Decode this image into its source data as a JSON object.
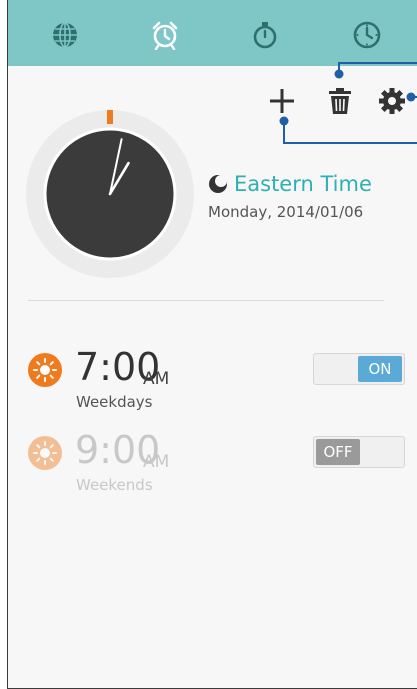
{
  "tabs": [
    {
      "name": "world-clock",
      "icon": "globe-icon"
    },
    {
      "name": "alarm",
      "icon": "alarm-clock-icon",
      "active": true
    },
    {
      "name": "stopwatch",
      "icon": "stopwatch-icon"
    },
    {
      "name": "timer",
      "icon": "timer-icon"
    }
  ],
  "toolbar": {
    "add_icon": "plus-icon",
    "delete_icon": "trash-icon",
    "settings_icon": "gear-icon"
  },
  "clock": {
    "hour": 1,
    "minute": 2,
    "second": 0
  },
  "timezone": {
    "name": "Eastern Time",
    "date": "Monday, 2014/01/06",
    "icon": "moon-icon"
  },
  "alarms": [
    {
      "time": "7:00",
      "ampm": "AM",
      "repeat": "Weekdays",
      "state": "ON",
      "enabled": true
    },
    {
      "time": "9:00",
      "ampm": "AM",
      "repeat": "Weekends",
      "state": "OFF",
      "enabled": false
    }
  ],
  "colors": {
    "tabbar": "#7fc6c6",
    "accent": "#2eb0b3",
    "sun": "#f07a1e",
    "toggle_on": "#5aa9d6",
    "toggle_off": "#9a9a9a",
    "callout": "#1f5fa8"
  }
}
